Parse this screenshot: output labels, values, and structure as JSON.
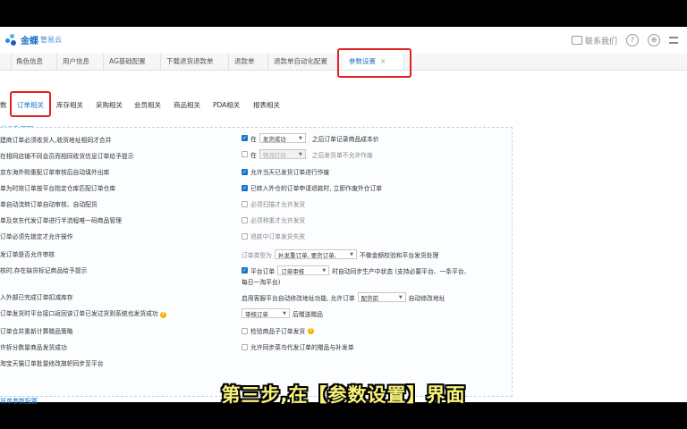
{
  "header": {
    "logo_text": "金蝶",
    "logo_sub": "管易云",
    "contact": "联系我们",
    "help_icon": "?",
    "lang_icon": "⊕"
  },
  "tabs": [
    {
      "label": "角色信息"
    },
    {
      "label": "用户信息"
    },
    {
      "label": "AG基础配置"
    },
    {
      "label": "下载退货退款单"
    },
    {
      "label": "退款单"
    },
    {
      "label": "退款单自动化配置"
    },
    {
      "label": "参数设置",
      "active": true
    }
  ],
  "subtabs": [
    {
      "label": "数"
    },
    {
      "label": "订单相关",
      "active": true
    },
    {
      "label": "库存相关"
    },
    {
      "label": "采购相关"
    },
    {
      "label": "会员相关"
    },
    {
      "label": "商品相关"
    },
    {
      "label": "PDA相关"
    },
    {
      "label": "报表相关"
    }
  ],
  "section_title": "单参数配置",
  "left_options": [
    "建商订单必须收货人,收货地址相同才合并",
    "在相同店铺不同会员而相同收货信息订单给予提示",
    "京东海外购重配订单审核后自动填外出库",
    "单为时效订单按平台指定仓库匹配订单仓库",
    "单自动流转订单自动审核、自动配货",
    "单及京东代发订单进行半流程唯一码商品管理",
    "订单必须先锁定才允许操作",
    "发订单是否允许审核",
    "核时,存在缺货标记商品给予提示",
    "入外部已完成订单扣减库存",
    "订单发货时平台接口返回该订单已发过货则系统也发货成功",
    "订单合并重新计算赠品策略",
    "许拆分数量商品发货成功",
    "淘宝天猫订单批量修改旗帜同步至平台"
  ],
  "right_options": {
    "r1": {
      "prefix": "在",
      "select": "发货成功",
      "suffix": "之后订单记录商品成本价"
    },
    "r2": {
      "prefix": "在",
      "select": "物流打印",
      "suffix": "之后发货单不允许作废"
    },
    "r3": {
      "label": "允许当天已发货订单进行作废"
    },
    "r4": {
      "label": "已转入外仓的订单申请退款时, 立即作废外仓订单"
    },
    "r5": {
      "label": "必须扫描才允许发货"
    },
    "r6": {
      "label": "必须称重才允许发货"
    },
    "r7": {
      "label": "退款中订单发货失败"
    },
    "r8": {
      "prefix": "订单类型为",
      "select": "补发重订单, 要货订单,",
      "suffix": "不做金额校验和平台发货处理"
    },
    "r9": {
      "prefix": "平台订单",
      "select": "订单审核",
      "suffix": "时自动同步生产中状态 (支持必要平台、一条平台、",
      "line2": "每日一淘平台)"
    },
    "r10": {
      "prefix": "启用客服平台自动修改地址功能, 允许订单",
      "select": "配货前",
      "suffix": "自动修改地址"
    },
    "r11": {
      "select": "审核订单",
      "suffix": "后赠送赠品"
    },
    "r12": {
      "label": "检验商品子订单发货"
    },
    "r13": {
      "label": "允许同步菜鸟代发订单的赠品与补发单"
    }
  },
  "bottom_section": "货单参数配置",
  "caption": "第三步,在【参数设置】界面",
  "colors": {
    "accent": "#1a73c8",
    "highlight": "#e02020",
    "caption": "#f7f27a"
  }
}
